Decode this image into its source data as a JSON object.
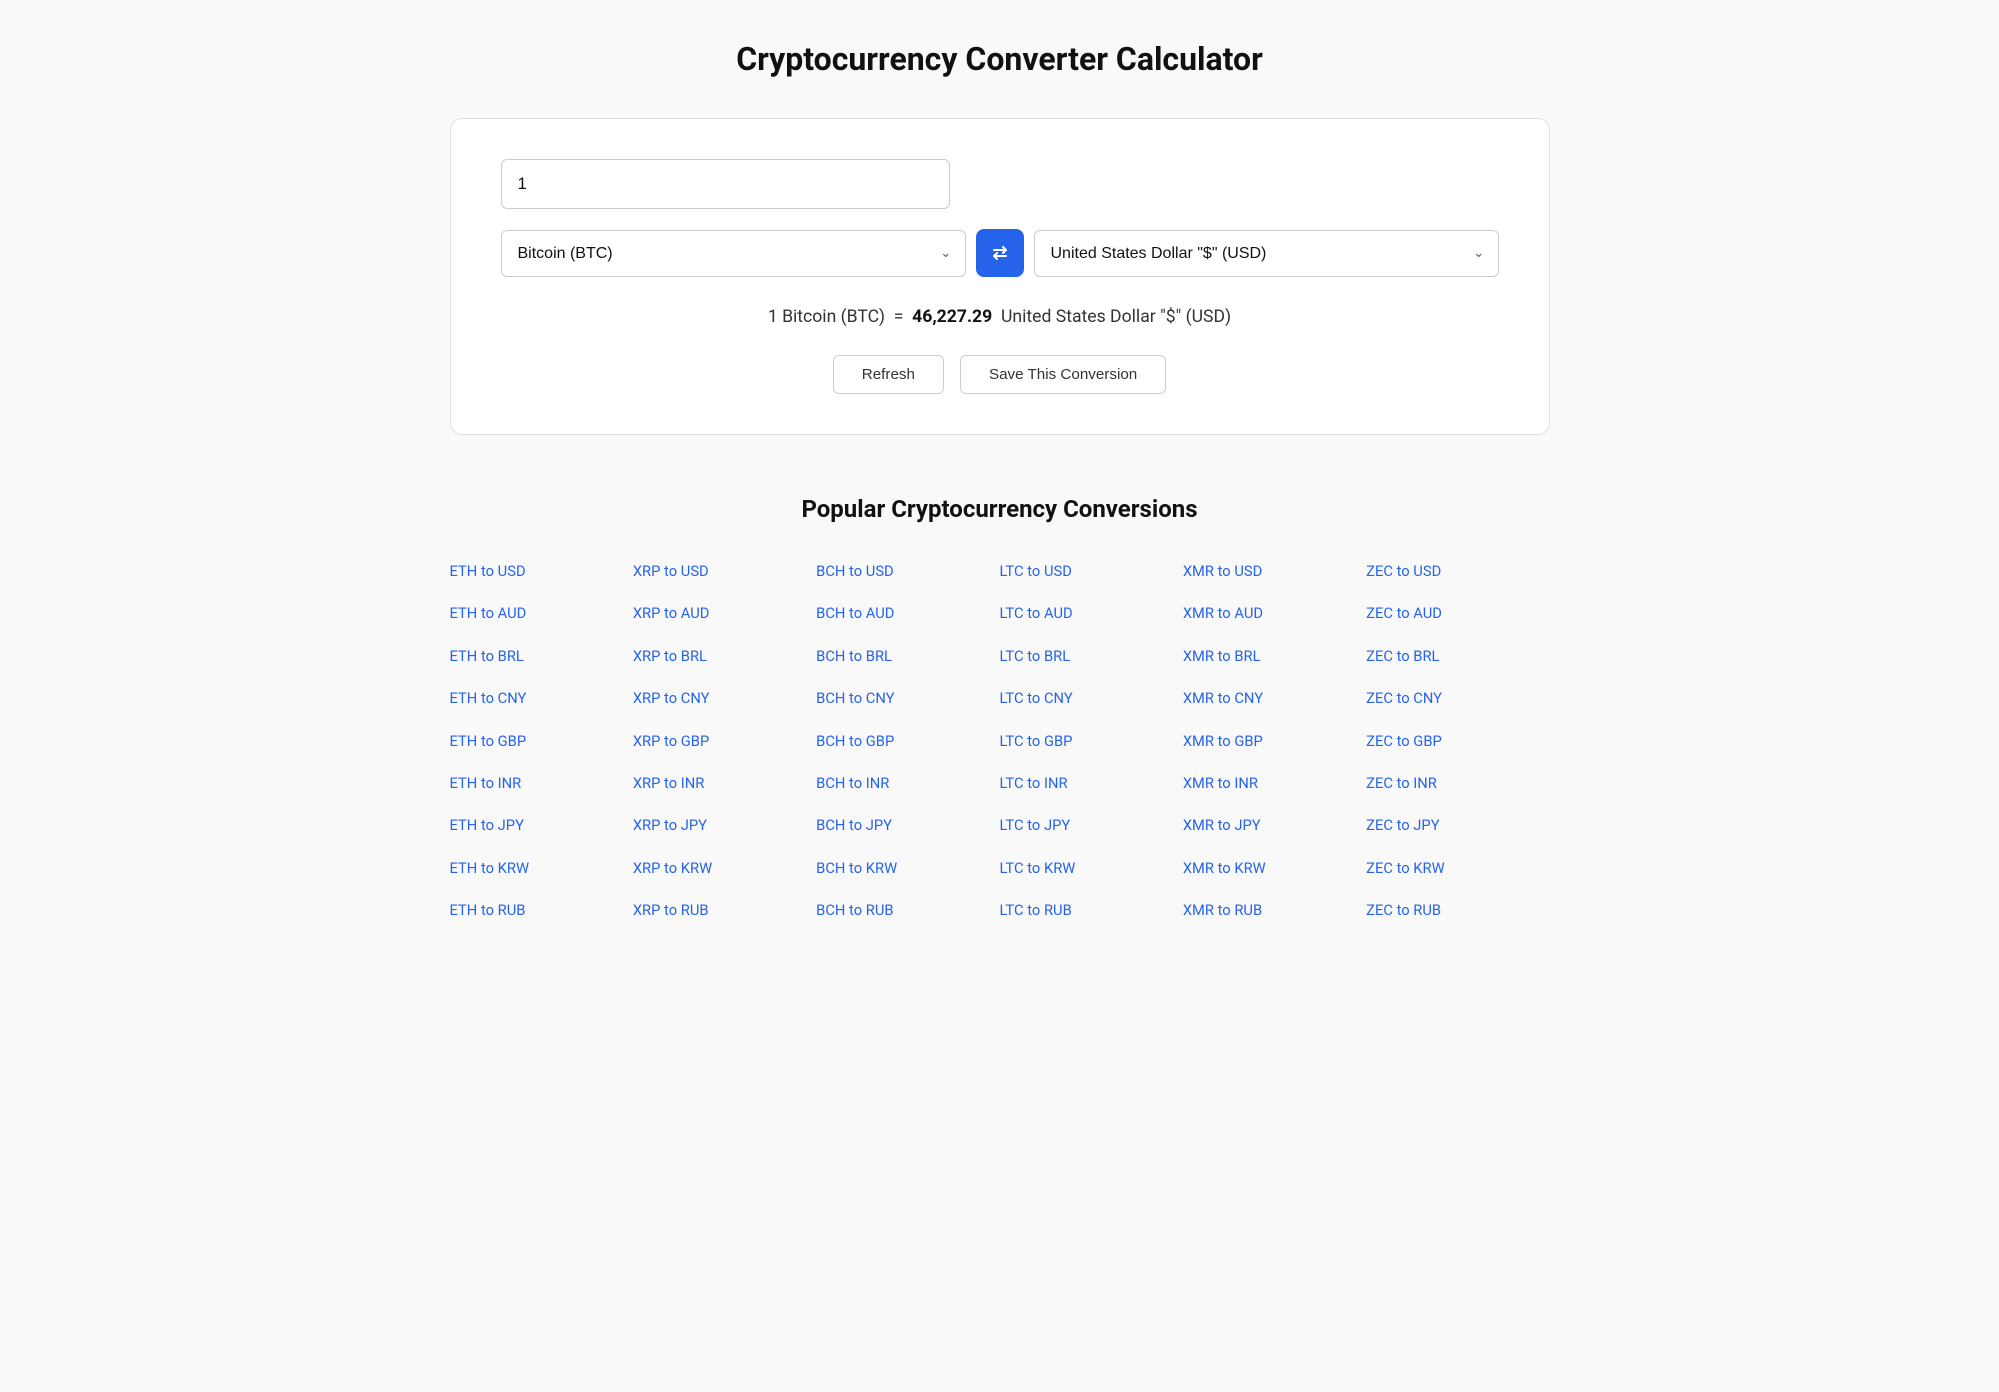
{
  "page": {
    "title": "Cryptocurrency Converter Calculator"
  },
  "converter": {
    "amount_value": "1",
    "from_currency": "Bitcoin (BTC)",
    "to_currency": "United States Dollar \"$\" (USD)",
    "result_text": "1 Bitcoin (BTC)",
    "equals": "=",
    "result_value": "46,227.29",
    "result_currency": "United States Dollar \"$\" (USD)",
    "swap_icon": "⇄",
    "chevron_down": "∨"
  },
  "buttons": {
    "refresh_label": "Refresh",
    "save_label": "Save This Conversion"
  },
  "popular": {
    "title": "Popular Cryptocurrency Conversions",
    "columns": [
      {
        "links": [
          "ETH to USD",
          "ETH to AUD",
          "ETH to BRL",
          "ETH to CNY",
          "ETH to GBP",
          "ETH to INR",
          "ETH to JPY",
          "ETH to KRW",
          "ETH to RUB"
        ]
      },
      {
        "links": [
          "XRP to USD",
          "XRP to AUD",
          "XRP to BRL",
          "XRP to CNY",
          "XRP to GBP",
          "XRP to INR",
          "XRP to JPY",
          "XRP to KRW",
          "XRP to RUB"
        ]
      },
      {
        "links": [
          "BCH to USD",
          "BCH to AUD",
          "BCH to BRL",
          "BCH to CNY",
          "BCH to GBP",
          "BCH to INR",
          "BCH to JPY",
          "BCH to KRW",
          "BCH to RUB"
        ]
      },
      {
        "links": [
          "LTC to USD",
          "LTC to AUD",
          "LTC to BRL",
          "LTC to CNY",
          "LTC to GBP",
          "LTC to INR",
          "LTC to JPY",
          "LTC to KRW",
          "LTC to RUB"
        ]
      },
      {
        "links": [
          "XMR to USD",
          "XMR to AUD",
          "XMR to BRL",
          "XMR to CNY",
          "XMR to GBP",
          "XMR to INR",
          "XMR to JPY",
          "XMR to KRW",
          "XMR to RUB"
        ]
      },
      {
        "links": [
          "ZEC to USD",
          "ZEC to AUD",
          "ZEC to BRL",
          "ZEC to CNY",
          "ZEC to GBP",
          "ZEC to INR",
          "ZEC to JPY",
          "ZEC to KRW",
          "ZEC to RUB"
        ]
      }
    ]
  }
}
